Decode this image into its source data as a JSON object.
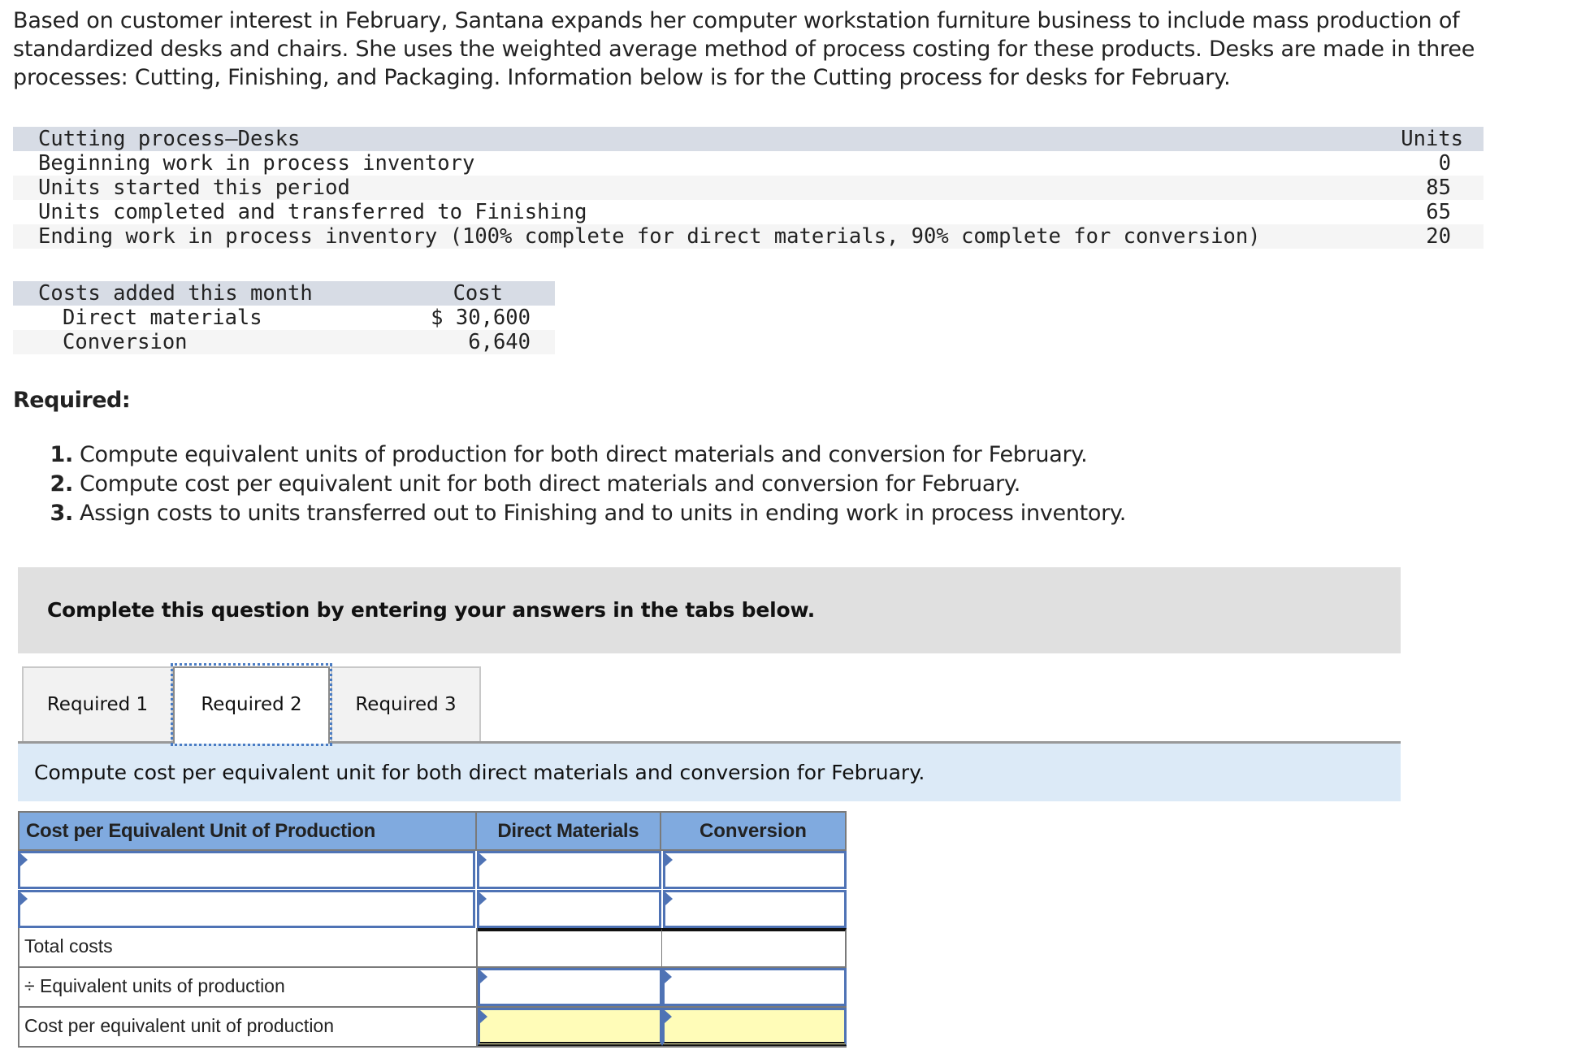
{
  "intro": {
    "text": "Based on customer interest in February, Santana expands her computer workstation furniture business to include mass production of standardized desks and chairs. She uses the weighted average method of process costing for these products. Desks are made in three processes: Cutting, Finishing, and Packaging. Information below is for the Cutting process for desks for February."
  },
  "process_table": {
    "header_label": "Cutting process—Desks",
    "header_value": "Units",
    "rows": [
      {
        "label": "Beginning work in process inventory",
        "value": "0"
      },
      {
        "label": "Units started this period",
        "value": "85"
      },
      {
        "label": "Units completed and transferred to Finishing",
        "value": "65"
      },
      {
        "label": "Ending work in process inventory (100% complete for direct materials, 90% complete for conversion)",
        "value": "20"
      }
    ]
  },
  "cost_table": {
    "header_label": "Costs added this month",
    "header_value": "Cost",
    "rows": [
      {
        "label": "Direct materials",
        "value": "$ 30,600"
      },
      {
        "label": "Conversion",
        "value": "6,640"
      }
    ]
  },
  "required": {
    "heading": "Required:",
    "items": [
      {
        "num": "1.",
        "text": "Compute equivalent units of production for both direct materials and conversion for February."
      },
      {
        "num": "2.",
        "text": "Compute cost per equivalent unit for both direct materials and conversion for February."
      },
      {
        "num": "3.",
        "text": "Assign costs to units transferred out to Finishing and to units in ending work in process inventory."
      }
    ]
  },
  "instruction": "Complete this question by entering your answers in the tabs below.",
  "tabs": [
    {
      "label": "Required 1",
      "active": false
    },
    {
      "label": "Required 2",
      "active": true
    },
    {
      "label": "Required 3",
      "active": false
    }
  ],
  "info": "Compute cost per equivalent unit for both direct materials and conversion for February.",
  "answer_table": {
    "headers": [
      "Cost per Equivalent Unit of Production",
      "Direct Materials",
      "Conversion"
    ],
    "input_rows": [
      {
        "label": "",
        "direct_materials": "",
        "conversion": ""
      },
      {
        "label": "",
        "direct_materials": "",
        "conversion": ""
      }
    ],
    "total_costs_label": "Total costs",
    "equiv_units_label": "÷ Equivalent units of production",
    "cost_per_unit_label": "Cost per equivalent unit of production"
  },
  "colors": {
    "table_header_blue": "#80aadf",
    "input_border_blue": "#4f73b5",
    "result_yellow": "#fffcb8",
    "info_banner": "#dceaf7",
    "instruction_banner": "#e0e0e0",
    "data_header_gray": "#d7dce5"
  }
}
